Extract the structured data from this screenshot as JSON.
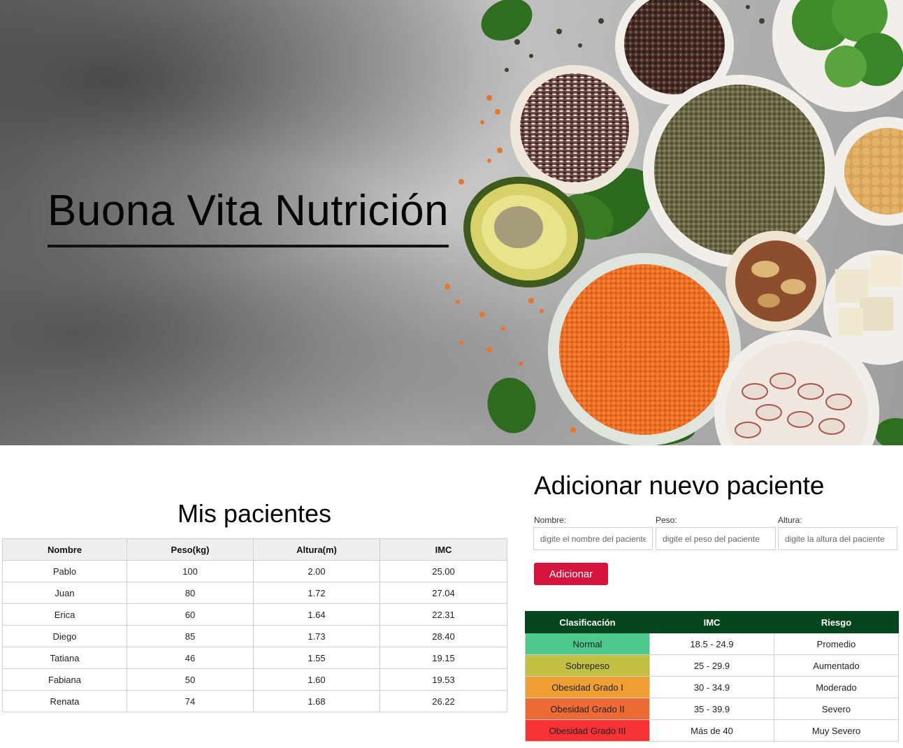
{
  "hero": {
    "title": "Buona Vita Nutrición"
  },
  "patients": {
    "title": "Mis pacientes",
    "columns": [
      "Nombre",
      "Peso(kg)",
      "Altura(m)",
      "IMC"
    ],
    "rows": [
      [
        "Pablo",
        "100",
        "2.00",
        "25.00"
      ],
      [
        "Juan",
        "80",
        "1.72",
        "27.04"
      ],
      [
        "Erica",
        "60",
        "1.64",
        "22.31"
      ],
      [
        "Diego",
        "85",
        "1.73",
        "28.40"
      ],
      [
        "Tatiana",
        "46",
        "1.55",
        "19.15"
      ],
      [
        "Fabiana",
        "50",
        "1.60",
        "19.53"
      ],
      [
        "Renata",
        "74",
        "1.68",
        "26.22"
      ]
    ]
  },
  "form": {
    "title": "Adicionar nuevo paciente",
    "nombre_label": "Nombre:",
    "nombre_placeholder": "digite el nombre del paciente",
    "peso_label": "Peso:",
    "peso_placeholder": "digite el peso del paciente",
    "altura_label": "Altura:",
    "altura_placeholder": "digite la altura del paciente",
    "submit_label": "Adicionar",
    "button_color": "#d4143f"
  },
  "classification": {
    "columns": [
      "Clasificación",
      "IMC",
      "Riesgo"
    ],
    "header_color": "#05461e",
    "rows": [
      {
        "label": "Normal",
        "imc": "18.5 - 24.9",
        "riesgo": "Promedio",
        "color": "#4dc98e"
      },
      {
        "label": "Sobrepeso",
        "imc": "25 - 29.9",
        "riesgo": "Aumentado",
        "color": "#c2c043"
      },
      {
        "label": "Obesidad Grado I",
        "imc": "30 - 34.9",
        "riesgo": "Moderado",
        "color": "#ef9f34"
      },
      {
        "label": "Obesidad Grado II",
        "imc": "35 - 39.9",
        "riesgo": "Severo",
        "color": "#ec6a34"
      },
      {
        "label": "Obesidad Grado III",
        "imc": "Más de 40",
        "riesgo": "Muy Severo",
        "color": "#f63235"
      }
    ]
  }
}
